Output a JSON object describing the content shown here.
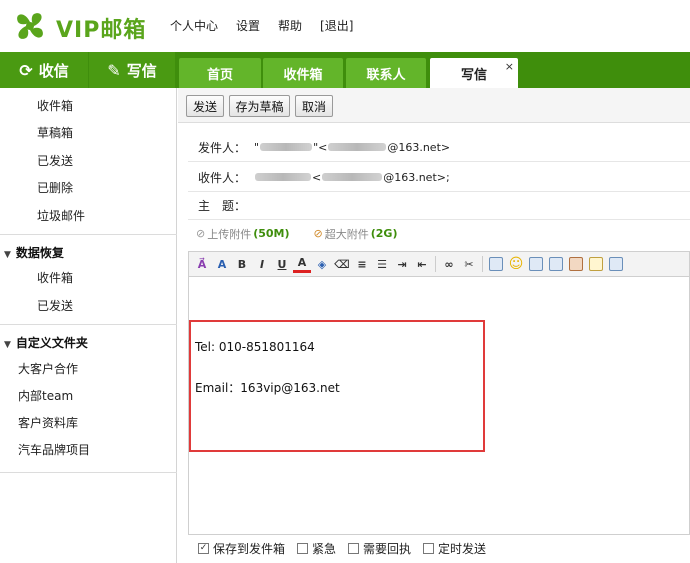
{
  "brand": {
    "name": "VIP邮箱",
    "color": "#5aa51c"
  },
  "topnav": [
    "个人中心",
    "设置",
    "帮助",
    "[退出]"
  ],
  "actions": {
    "receive": "收信",
    "compose": "写信"
  },
  "tabs": [
    {
      "label": "首页",
      "active": false
    },
    {
      "label": "收件箱",
      "active": false
    },
    {
      "label": "联系人",
      "active": false
    },
    {
      "label": "写信",
      "active": true,
      "close": "×"
    }
  ],
  "sidebar": {
    "folders": [
      "收件箱",
      "草稿箱",
      "已发送",
      "已删除",
      "垃圾邮件"
    ],
    "recovery": {
      "title": "数据恢复",
      "items": [
        "收件箱",
        "已发送"
      ]
    },
    "custom": {
      "title": "自定义文件夹",
      "items": [
        "大客户合作",
        "内部team",
        "客户资料库",
        "汽车品牌项目"
      ]
    }
  },
  "toolbar": {
    "send": "发送",
    "save_draft": "存为草稿",
    "cancel": "取消"
  },
  "compose": {
    "from_label": "发件人：",
    "from_prefix": "\"",
    "from_mid": "\"<",
    "from_suffix": "@163.net>",
    "to_label": "收件人：",
    "to_mid": "<",
    "to_suffix": "@163.net>;",
    "subject_label": "主　题：",
    "attach_label": "上传附件",
    "attach_size": "(50M)",
    "big_attach_label": "超大附件",
    "big_attach_size": "(2G)"
  },
  "editor_icons": [
    "format-painter-icon",
    "font-icon",
    "bold-icon",
    "italic-icon",
    "underline-icon",
    "font-color-icon",
    "highlight-icon",
    "eraser-icon",
    "align-icon",
    "list-icon",
    "indent-icon",
    "outdent-icon",
    "link-icon",
    "unlink-icon",
    "image-icon",
    "emoji-icon",
    "note-icon",
    "screen-icon",
    "screenshot-icon",
    "calendar-icon",
    "card-icon"
  ],
  "body": {
    "tel": "Tel: 010-851801164",
    "email": "Email：163vip@163.net"
  },
  "options": [
    {
      "label": "保存到发件箱",
      "checked": true
    },
    {
      "label": "紧急",
      "checked": false
    },
    {
      "label": "需要回执",
      "checked": false
    },
    {
      "label": "定时发送",
      "checked": false
    }
  ],
  "colors": {
    "green_dark": "#3f8e0c",
    "green_tab": "#63b52a",
    "highlight_border": "#e03a3a"
  }
}
